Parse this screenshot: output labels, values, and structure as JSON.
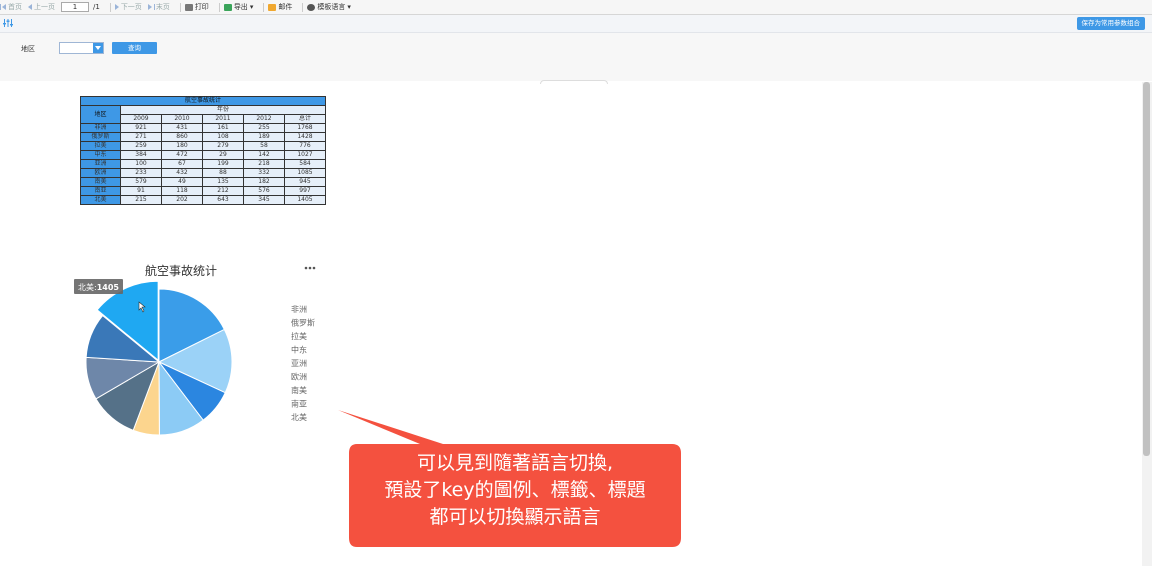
{
  "toolbar": {
    "first": "首页",
    "prev": "上一页",
    "page": "1",
    "total": "/1",
    "next": "下一页",
    "last": "末页",
    "print": "打印",
    "export": "导出",
    "mail": "邮件",
    "language": "模板语言"
  },
  "bar2": {
    "save_combo": "保存为常用参数组合"
  },
  "filter": {
    "region_label": "地区",
    "region_value": "",
    "query_button": "查询"
  },
  "table": {
    "title": "航空事故统计",
    "region_header": "地区",
    "year_header": "年份",
    "columns": [
      "2009",
      "2010",
      "2011",
      "2012",
      "总计"
    ],
    "rows": [
      {
        "region": "非洲",
        "values": [
          "921",
          "431",
          "161",
          "255",
          "1768"
        ]
      },
      {
        "region": "俄罗斯",
        "values": [
          "271",
          "860",
          "108",
          "189",
          "1428"
        ]
      },
      {
        "region": "拉美",
        "values": [
          "259",
          "180",
          "279",
          "58",
          "776"
        ]
      },
      {
        "region": "中东",
        "values": [
          "384",
          "472",
          "29",
          "142",
          "1027"
        ]
      },
      {
        "region": "亚洲",
        "values": [
          "100",
          "67",
          "199",
          "218",
          "584"
        ]
      },
      {
        "region": "欧洲",
        "values": [
          "233",
          "432",
          "88",
          "332",
          "1085"
        ]
      },
      {
        "region": "南美",
        "values": [
          "579",
          "49",
          "135",
          "182",
          "945"
        ]
      },
      {
        "region": "南亚",
        "values": [
          "91",
          "118",
          "212",
          "576",
          "997"
        ]
      },
      {
        "region": "北美",
        "values": [
          "215",
          "202",
          "643",
          "345",
          "1405"
        ]
      }
    ]
  },
  "chart_data": {
    "type": "pie",
    "title": "航空事故统计",
    "more_icon": "more-dots-icon",
    "categories": [
      "非洲",
      "俄罗斯",
      "拉美",
      "中东",
      "亚洲",
      "欧洲",
      "南美",
      "南亚",
      "北美"
    ],
    "values": [
      1768,
      1428,
      776,
      1027,
      584,
      1085,
      945,
      997,
      1405
    ],
    "colors": [
      "#3a9de9",
      "#9bd2f7",
      "#2b86e0",
      "#8ccbf5",
      "#fcd58e",
      "#557188",
      "#6e87a9",
      "#3a78b8",
      "#1fa8f2"
    ],
    "legend_position": "right",
    "highlighted": "北美",
    "tooltip": {
      "label": "北美",
      "value": "1405"
    }
  },
  "callout": {
    "lines": [
      "可以見到隨著語言切換,",
      "預設了key的圖例、標籤、標題",
      "都可以切換顯示語言"
    ],
    "color": "#f4513f"
  }
}
